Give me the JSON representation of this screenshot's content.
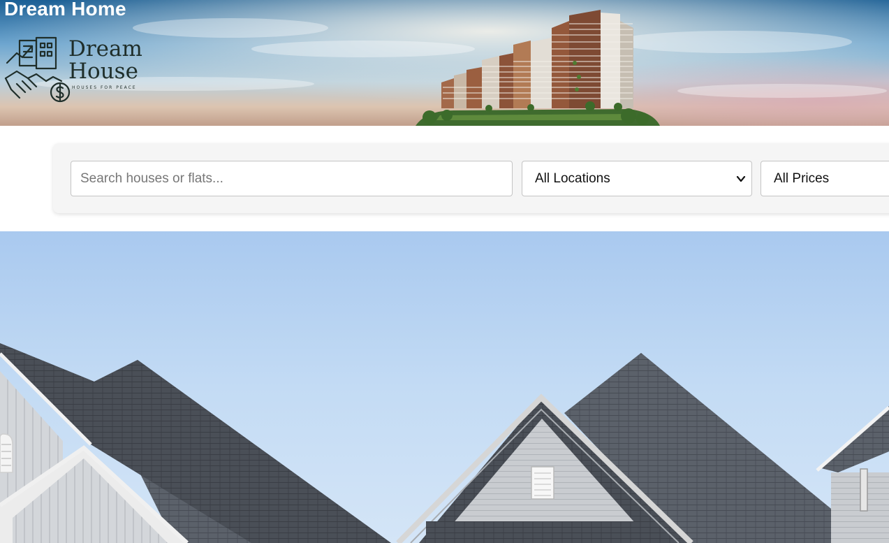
{
  "header": {
    "site_title": "Dream Home",
    "logo": {
      "line1": "Dream",
      "line2": "House",
      "tagline": "HOUSES FOR PEACE"
    }
  },
  "search": {
    "placeholder": "Search houses or flats...",
    "value": "",
    "location_select": {
      "selected": "All Locations",
      "icon": "chevron-down-icon"
    },
    "price_select": {
      "selected": "All Prices"
    }
  },
  "hero": {
    "description_icon": "house-roofs-photo"
  },
  "colors": {
    "title_text": "#ffffff",
    "panel_bg": "#f5f5f5",
    "input_border": "#c4c4c4",
    "sky": "#b9d4f2",
    "roof": "#4a4f57"
  }
}
